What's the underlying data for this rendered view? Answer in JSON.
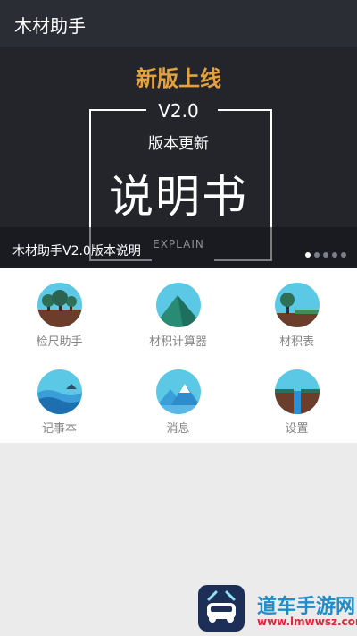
{
  "app_bar": {
    "title": "木材助手"
  },
  "banner": {
    "headline": "新版上线",
    "version": "V2.0",
    "subtitle": "版本更新",
    "big_text": "说明书",
    "explain": "EXPLAIN",
    "caption": "木材助手V2.0版本说明",
    "pager": {
      "count": 5,
      "active_index": 0
    }
  },
  "grid": {
    "items": [
      {
        "label": "检尺助手",
        "icon": "forest-trees-icon"
      },
      {
        "label": "材积计算器",
        "icon": "mountain-icon"
      },
      {
        "label": "材积表",
        "icon": "tree-grass-icon"
      },
      {
        "label": "记事本",
        "icon": "sea-waves-icon"
      },
      {
        "label": "消息",
        "icon": "snow-mountain-icon"
      },
      {
        "label": "设置",
        "icon": "waterfall-icon"
      }
    ]
  },
  "watermark": {
    "name": "道车手游网",
    "url": "www.lmwwsz.com"
  },
  "colors": {
    "app_bar": "#2b2d35",
    "accent": "#e5a13a",
    "icon_sky": "#5bc8e6",
    "watermark_blue": "#1f8ec8",
    "watermark_red": "#e0283c"
  }
}
